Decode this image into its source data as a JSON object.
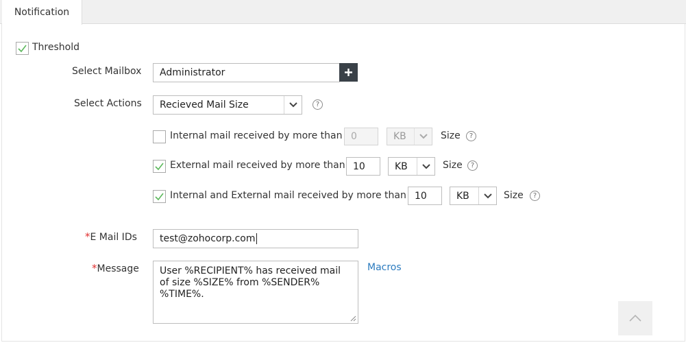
{
  "tabs": {
    "notification": "Notification"
  },
  "threshold": {
    "label": "Threshold",
    "checked": true
  },
  "mailbox": {
    "label": "Select Mailbox",
    "value": "Administrator",
    "add_icon": "plus-icon"
  },
  "actions": {
    "label": "Select Actions",
    "value": "Recieved Mail Size",
    "help_icon": "help-icon"
  },
  "conditions": [
    {
      "label": "Internal mail received by more than",
      "checked": false,
      "value": "0",
      "unit": "KB",
      "size_label": "Size",
      "disabled": true
    },
    {
      "label": "External mail received by more than",
      "checked": true,
      "value": "10",
      "unit": "KB",
      "size_label": "Size",
      "disabled": false
    },
    {
      "label": "Internal and External mail received by more than",
      "checked": true,
      "value": "10",
      "unit": "KB",
      "size_label": "Size",
      "disabled": false
    }
  ],
  "email": {
    "required_mark": "*",
    "label": "E Mail IDs",
    "value": "test@zohocorp.com"
  },
  "message": {
    "required_mark": "*",
    "label": "Message",
    "value": "User %RECIPIENT% has received mail\nof size %SIZE% from %SENDER%\n%TIME%.",
    "macros_link": "Macros"
  },
  "help_glyph": "?",
  "colors": {
    "check": "#5cb85c",
    "link": "#2b7bbf",
    "required": "#e03131",
    "button_dark": "#3a4148"
  }
}
